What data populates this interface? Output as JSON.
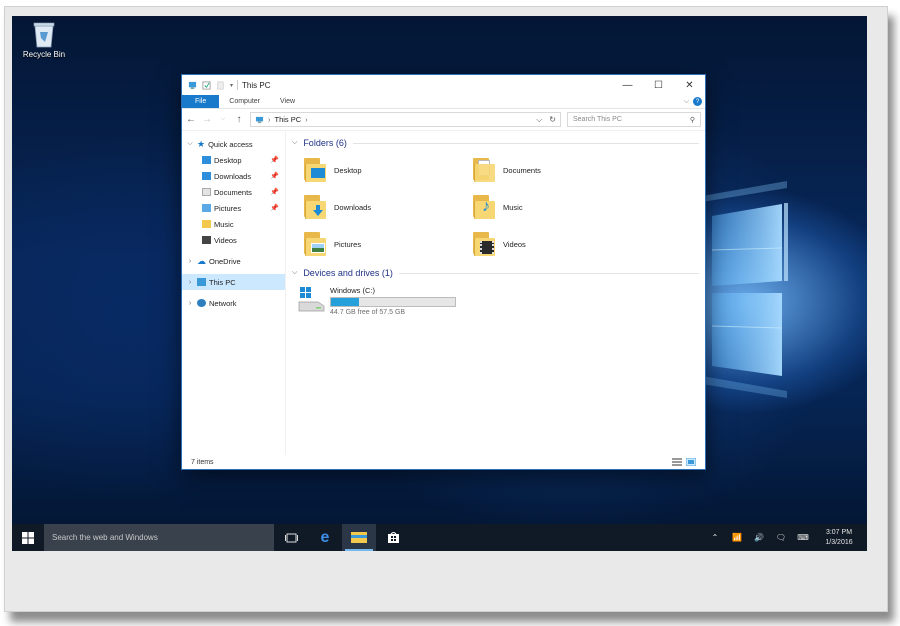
{
  "desktop": {
    "recycle_bin_label": "Recycle Bin"
  },
  "window": {
    "title": "This PC",
    "controls": {
      "minimize": "—",
      "maximize": "☐",
      "close": "✕"
    },
    "ribbon_tabs": [
      {
        "label": "File",
        "active": true
      },
      {
        "label": "Computer"
      },
      {
        "label": "View"
      }
    ],
    "help": "?",
    "address": {
      "location": "This PC"
    },
    "search": {
      "placeholder": "Search This PC"
    },
    "nav_pane": {
      "quick_access": "Quick access",
      "quick_items": [
        {
          "label": "Desktop",
          "icon": "desktop-folder-icon",
          "pinned": true
        },
        {
          "label": "Downloads",
          "icon": "downloads-folder-icon",
          "pinned": true
        },
        {
          "label": "Documents",
          "icon": "documents-folder-icon",
          "pinned": true
        },
        {
          "label": "Pictures",
          "icon": "pictures-folder-icon",
          "pinned": true
        },
        {
          "label": "Music",
          "icon": "music-folder-icon",
          "pinned": false
        },
        {
          "label": "Videos",
          "icon": "videos-folder-icon",
          "pinned": false
        }
      ],
      "onedrive": "OneDrive",
      "this_pc": "This PC",
      "network": "Network"
    },
    "content": {
      "folders_header": "Folders (6)",
      "folders": [
        {
          "label": "Desktop",
          "icon": "desktop-folder-icon"
        },
        {
          "label": "Documents",
          "icon": "documents-folder-icon"
        },
        {
          "label": "Downloads",
          "icon": "downloads-folder-icon"
        },
        {
          "label": "Music",
          "icon": "music-folder-icon"
        },
        {
          "label": "Pictures",
          "icon": "pictures-folder-icon"
        },
        {
          "label": "Videos",
          "icon": "videos-folder-icon"
        }
      ],
      "drives_header": "Devices and drives (1)",
      "drive": {
        "label": "Windows (C:)",
        "free_text": "44.7 GB free of 57.5 GB",
        "used_fraction": 0.223
      }
    },
    "status": {
      "items": "7 items"
    }
  },
  "taskbar": {
    "search_placeholder": "Search the web and Windows",
    "time": "3:07 PM",
    "date": "1/3/2016"
  },
  "colors": {
    "accent": "#1979ca",
    "drive_fill": "#26a0da",
    "folder_yellow": "#f7d774",
    "taskbar": "#101a26"
  }
}
